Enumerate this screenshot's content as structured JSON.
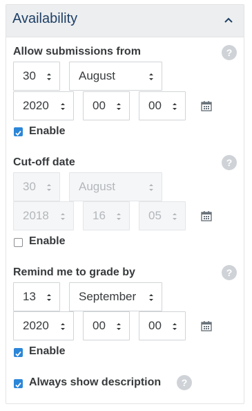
{
  "panel": {
    "title": "Availability"
  },
  "sections": {
    "allow": {
      "label": "Allow submissions from",
      "day": "30",
      "month": "August",
      "year": "2020",
      "hour": "00",
      "minute": "00",
      "enable_label": "Enable",
      "enabled": true,
      "help": "?"
    },
    "cutoff": {
      "label": "Cut-off date",
      "day": "30",
      "month": "August",
      "year": "2018",
      "hour": "16",
      "minute": "05",
      "enable_label": "Enable",
      "enabled": false,
      "help": "?"
    },
    "remind": {
      "label": "Remind me to grade by",
      "day": "13",
      "month": "September",
      "year": "2020",
      "hour": "00",
      "minute": "00",
      "enable_label": "Enable",
      "enabled": true,
      "help": "?"
    }
  },
  "always_show": {
    "label": "Always show description",
    "checked": true,
    "help": "?"
  },
  "colors": {
    "accent": "#2b86d8",
    "title": "#1e3f66",
    "header_bg": "#eceeef"
  }
}
